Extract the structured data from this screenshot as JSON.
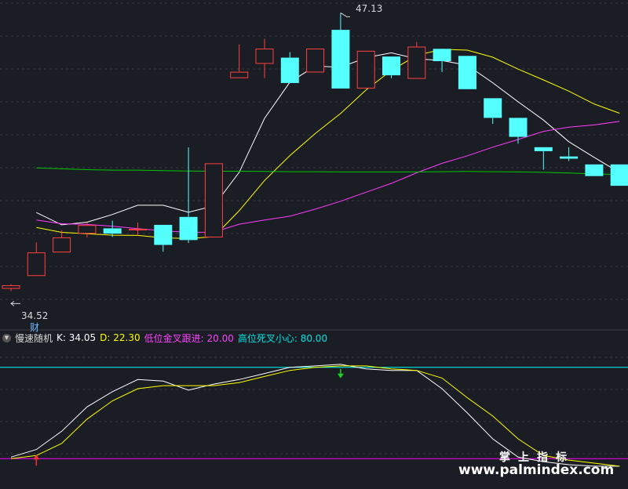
{
  "main_chart": {
    "high_label": "47.13",
    "low_label": "34.52",
    "low_tag": "财"
  },
  "indicator": {
    "name": "慢速随机",
    "k_label": "K:",
    "k_value": "34.05",
    "d_label": "D:",
    "d_value": "22.30",
    "low_cross_label": "低位金叉跟进:",
    "low_cross_value": "20.00",
    "high_cross_label": "高位死叉小心:",
    "high_cross_value": "80.00"
  },
  "watermark": {
    "line1": "掌上指标",
    "line2": "www.palmindex.com"
  },
  "colors": {
    "up": "#ff4040",
    "down": "#54ffff",
    "ma_white": "#ffffff",
    "ma_yellow": "#ffff00",
    "ma_magenta": "#ff3cff",
    "ma_green": "#00c800",
    "k_line": "#ffffff",
    "d_line": "#ffff00",
    "level_high": "#00ffff",
    "level_low": "#ff00ff"
  },
  "chart_data": [
    {
      "type": "candlestick",
      "title": "",
      "annotations": [
        {
          "label": "47.13",
          "type": "high"
        },
        {
          "label": "34.52",
          "type": "low"
        }
      ],
      "ylim": [
        34.0,
        47.5
      ],
      "candles": [
        {
          "o": 34.62,
          "h": 34.82,
          "l": 34.52,
          "c": 34.78
        },
        {
          "o": 35.2,
          "h": 36.72,
          "l": 35.2,
          "c": 36.27
        },
        {
          "o": 36.27,
          "h": 37.28,
          "l": 36.27,
          "c": 36.95
        },
        {
          "o": 37.12,
          "h": 37.63,
          "l": 36.95,
          "c": 37.51
        },
        {
          "o": 37.36,
          "h": 37.71,
          "l": 36.97,
          "c": 37.12
        },
        {
          "o": 37.31,
          "h": 37.63,
          "l": 37.04,
          "c": 37.34
        },
        {
          "o": 37.52,
          "h": 37.52,
          "l": 36.3,
          "c": 36.61
        },
        {
          "o": 37.88,
          "h": 41.03,
          "l": 36.7,
          "c": 36.83
        },
        {
          "o": 36.95,
          "h": 40.31,
          "l": 36.95,
          "c": 40.31
        },
        {
          "o": 44.17,
          "h": 45.7,
          "l": 44.17,
          "c": 44.46
        },
        {
          "o": 44.82,
          "h": 45.95,
          "l": 44.17,
          "c": 45.51
        },
        {
          "o": 45.1,
          "h": 45.35,
          "l": 43.95,
          "c": 43.95
        },
        {
          "o": 44.43,
          "h": 45.51,
          "l": 44.43,
          "c": 45.51
        },
        {
          "o": 46.36,
          "h": 47.13,
          "l": 43.7,
          "c": 43.7
        },
        {
          "o": 43.7,
          "h": 45.41,
          "l": 43.7,
          "c": 45.41
        },
        {
          "o": 45.15,
          "h": 45.15,
          "l": 44.17,
          "c": 44.3
        },
        {
          "o": 44.14,
          "h": 45.81,
          "l": 44.14,
          "c": 45.6
        },
        {
          "o": 45.5,
          "h": 45.5,
          "l": 44.45,
          "c": 44.94
        },
        {
          "o": 45.18,
          "h": 45.18,
          "l": 43.67,
          "c": 43.67
        },
        {
          "o": 43.26,
          "h": 43.26,
          "l": 42.1,
          "c": 42.37
        },
        {
          "o": 42.37,
          "h": 42.37,
          "l": 41.2,
          "c": 41.51
        },
        {
          "o": 41.04,
          "h": 41.04,
          "l": 40.02,
          "c": 40.86
        },
        {
          "o": 40.62,
          "h": 41.04,
          "l": 40.41,
          "c": 40.52
        },
        {
          "o": 40.26,
          "h": 40.26,
          "l": 39.73,
          "c": 39.73
        },
        {
          "o": 40.26,
          "h": 40.26,
          "l": 39.29,
          "c": 39.29
        }
      ],
      "ma": [
        {
          "color": "white",
          "values": [
            null,
            38.08,
            37.52,
            37.64,
            37.99,
            38.41,
            38.41,
            38.09,
            38.38,
            39.9,
            42.35,
            43.99,
            44.72,
            44.66,
            45.1,
            45.32,
            45.05,
            44.97,
            44.75,
            43.96,
            43.1,
            42.27,
            41.29,
            40.58,
            39.89
          ]
        },
        {
          "color": "yellow",
          "values": [
            null,
            37.4,
            37.18,
            37.12,
            37.05,
            37.04,
            36.93,
            36.9,
            36.98,
            38.16,
            39.53,
            40.66,
            41.66,
            42.57,
            43.63,
            44.52,
            45.2,
            45.48,
            45.44,
            45.12,
            44.58,
            44.09,
            43.58,
            43.0,
            42.58
          ]
        },
        {
          "color": "magenta",
          "values": [
            null,
            37.74,
            37.57,
            37.54,
            37.46,
            37.35,
            37.25,
            37.18,
            37.19,
            37.55,
            37.74,
            37.91,
            38.23,
            38.59,
            39.0,
            39.4,
            39.88,
            40.31,
            40.65,
            41.04,
            41.39,
            41.76,
            41.95,
            42.05,
            42.21
          ]
        },
        {
          "color": "green",
          "values": [
            null,
            40.1,
            40.06,
            40.02,
            40.0,
            40.0,
            39.98,
            39.96,
            39.95,
            39.95,
            39.94,
            39.93,
            39.93,
            39.92,
            39.92,
            39.92,
            39.92,
            39.93,
            39.94,
            39.93,
            39.92,
            39.9,
            39.87,
            39.83,
            39.8
          ]
        }
      ]
    },
    {
      "type": "line",
      "title": "慢速随机",
      "ylim": [
        0,
        100
      ],
      "hlines": [
        {
          "label": "低位金叉跟进",
          "value": 20.0
        },
        {
          "label": "高位死叉小心",
          "value": 80.0
        }
      ],
      "markers": [
        {
          "index": 1,
          "direction": "up",
          "color": "#ff3030"
        },
        {
          "index": 13,
          "direction": "down",
          "color": "#20d020"
        }
      ],
      "x": [
        0,
        1,
        2,
        3,
        4,
        5,
        6,
        7,
        8,
        9,
        10,
        11,
        12,
        13,
        14,
        15,
        16,
        17,
        18,
        19,
        20,
        21,
        22,
        23,
        24
      ],
      "series": [
        {
          "name": "K",
          "values": [
            21,
            26,
            38,
            54,
            64,
            72,
            71,
            65,
            69,
            72,
            76,
            80,
            81,
            82,
            79,
            78,
            78,
            66,
            50,
            33,
            21,
            18,
            16,
            15,
            15
          ]
        },
        {
          "name": "D",
          "values": [
            20,
            22,
            30,
            46,
            58,
            66,
            68,
            68,
            68,
            70,
            74,
            78,
            80,
            81,
            81,
            79,
            78,
            73,
            60,
            48,
            33,
            22,
            19,
            17,
            15
          ]
        }
      ]
    }
  ]
}
